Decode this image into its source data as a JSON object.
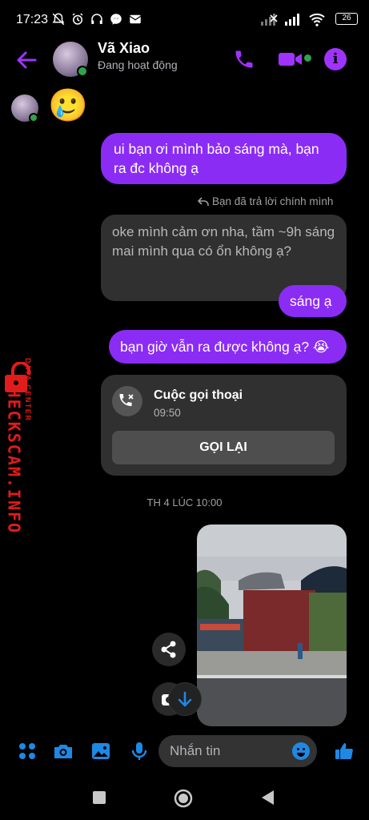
{
  "status_bar": {
    "time": "17:23",
    "battery": "26"
  },
  "header": {
    "name": "Vã Xiao",
    "status": "Đang hoạt động"
  },
  "messages": {
    "emoji": "🥲",
    "m1": "ui bạn ơi mình bảo sáng mà, bạn ra đc không ạ",
    "reply_note": "Bạn đã trả lời chính mình",
    "m2": "oke mình cảm ơn nha, tầm ~9h sáng mai mình qua có ổn không ạ?",
    "m3": "sáng ạ",
    "m4": "bạn giờ vẫn ra được không ạ? 😭"
  },
  "call_card": {
    "title": "Cuộc gọi thoại",
    "time": "09:50",
    "button": "GỌI LẠI"
  },
  "timestamp": "TH 4 LÚC 10:00",
  "watermark": {
    "main": "CHECKSCAM.INFO",
    "sub": "DATA CENTER"
  },
  "composer": {
    "placeholder": "Nhắn tin"
  },
  "colors": {
    "accent": "#a033ff",
    "bubble_out": "#8b2cf5",
    "bubble_in": "#303030",
    "composer_icons": "#1e88e5",
    "online": "#31a24c",
    "watermark": "#e21b1b"
  }
}
